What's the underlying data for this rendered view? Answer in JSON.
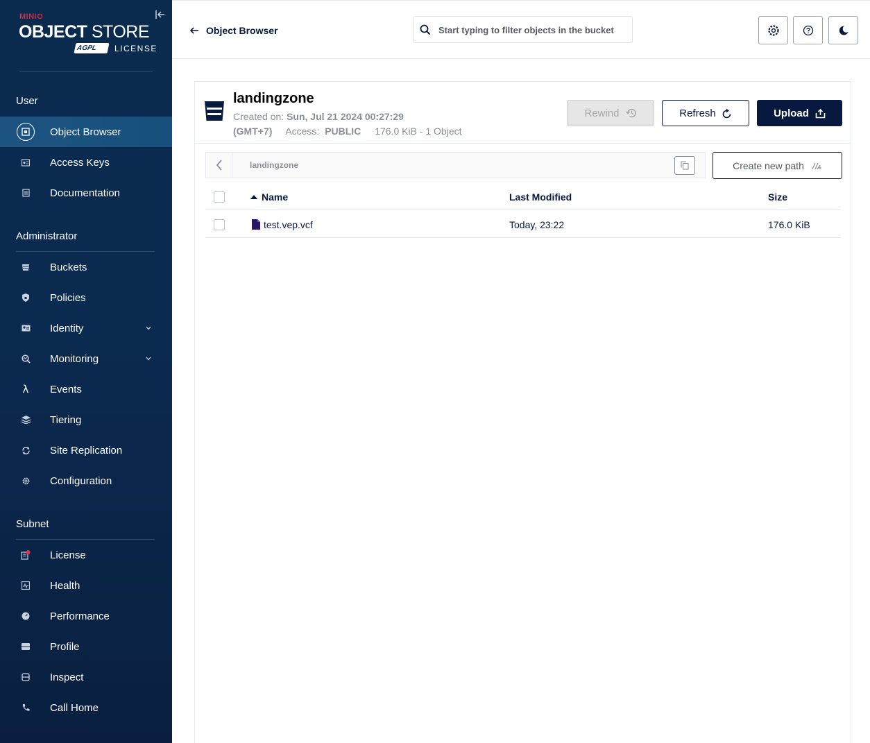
{
  "brand": {
    "vendor": "MINIO",
    "product_bold": "OBJECT",
    "product_light": "STORE",
    "license_badge": "AGPL",
    "license_label": "LICENSE"
  },
  "sidebar": {
    "sections": [
      {
        "title": "User",
        "items": [
          {
            "label": "Object Browser",
            "icon": "object-browser-icon",
            "active": true
          },
          {
            "label": "Access Keys",
            "icon": "access-keys-icon"
          },
          {
            "label": "Documentation",
            "icon": "documentation-icon"
          }
        ]
      },
      {
        "title": "Administrator",
        "items": [
          {
            "label": "Buckets",
            "icon": "buckets-icon"
          },
          {
            "label": "Policies",
            "icon": "policies-icon"
          },
          {
            "label": "Identity",
            "icon": "identity-icon",
            "expandable": true
          },
          {
            "label": "Monitoring",
            "icon": "monitoring-icon",
            "expandable": true
          },
          {
            "label": "Events",
            "icon": "lambda-icon"
          },
          {
            "label": "Tiering",
            "icon": "tiering-icon"
          },
          {
            "label": "Site Replication",
            "icon": "replication-icon"
          },
          {
            "label": "Configuration",
            "icon": "gear-icon"
          }
        ]
      },
      {
        "title": "Subnet",
        "items": [
          {
            "label": "License",
            "icon": "license-icon"
          },
          {
            "label": "Health",
            "icon": "health-icon"
          },
          {
            "label": "Performance",
            "icon": "performance-icon"
          },
          {
            "label": "Profile",
            "icon": "profile-icon"
          },
          {
            "label": "Inspect",
            "icon": "inspect-icon"
          },
          {
            "label": "Call Home",
            "icon": "call-home-icon"
          }
        ]
      }
    ]
  },
  "header": {
    "back_label": "Object Browser",
    "search_placeholder": "Start typing to filter objects in the bucket"
  },
  "bucket": {
    "name": "landingzone",
    "created_label": "Created on:",
    "created_value": "Sun, Jul 21 2024 00:27:29",
    "timezone": "(GMT+7)",
    "access_label": "Access:",
    "access_value": "PUBLIC",
    "usage": "176.0 KiB - 1 Object"
  },
  "actions": {
    "rewind": "Rewind",
    "refresh": "Refresh",
    "upload": "Upload",
    "new_path": "Create new path"
  },
  "path": {
    "current": "landingzone"
  },
  "table": {
    "columns": {
      "name": "Name",
      "modified": "Last Modified",
      "size": "Size"
    },
    "rows": [
      {
        "name": "test.vep.vcf",
        "modified": "Today, 23:22",
        "size": "176.0 KiB"
      }
    ]
  },
  "colors": {
    "sidebar_bg": "#0b2a50",
    "active_item": "#1d5380",
    "primary": "#07193e",
    "brand_red": "#c72e49",
    "license_dot": "#e0334f"
  }
}
